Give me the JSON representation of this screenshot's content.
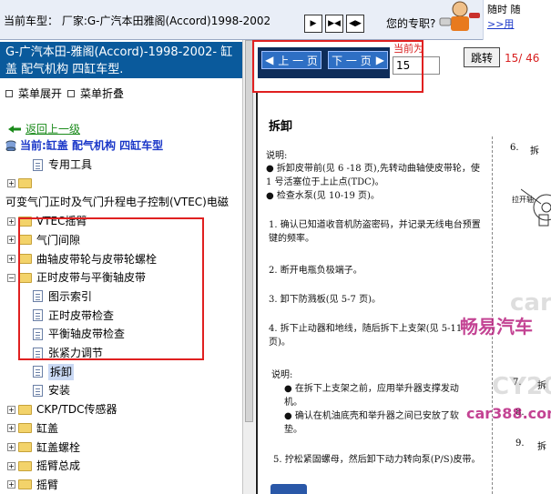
{
  "header": {
    "model_label": "当前车型： 厂家:G-广汽本田雅阁(Accord)1998-2002",
    "nav_buttons": [
      "▶",
      "▶◀",
      "◀▶"
    ],
    "purchase_label": "您的专职?",
    "promo_text": "随时 随",
    "promo_link": ">>用"
  },
  "left": {
    "model_title": "G-广汽本田-雅阁(Accord)-1998-2002- 缸盖 配气机构 四缸车型.",
    "menu_expand": "菜单展开",
    "menu_collapse": "菜单折叠",
    "back_link": "返回上一级",
    "current": "当前:缸盖 配气机构 四缸车型",
    "tree": [
      {
        "label": "专用工具",
        "type": "doc",
        "level": 1
      },
      {
        "label": "",
        "type": "folder",
        "level": 0
      },
      {
        "label": "可变气门正时及气门升程电子控制(VTEC)电磁",
        "type": "text",
        "level": 0
      },
      {
        "label": "VTEC摇臂",
        "type": "folder",
        "level": 0
      },
      {
        "label": "气门间隙",
        "type": "folder",
        "level": 0
      },
      {
        "label": "曲轴皮带轮与皮带轮螺栓",
        "type": "folder",
        "level": 0
      },
      {
        "label": "正时皮带与平衡轴皮带",
        "type": "folder",
        "level": 0,
        "expanded": true
      },
      {
        "label": "图示索引",
        "type": "doc",
        "level": 1
      },
      {
        "label": "正时皮带检查",
        "type": "doc",
        "level": 1
      },
      {
        "label": "平衡轴皮带检查",
        "type": "doc",
        "level": 1
      },
      {
        "label": "张紧力调节",
        "type": "doc",
        "level": 1
      },
      {
        "label": "拆卸",
        "type": "doc",
        "level": 1,
        "selected": true
      },
      {
        "label": "安装",
        "type": "doc",
        "level": 1
      },
      {
        "label": "CKP/TDC传感器",
        "type": "folder",
        "level": 0
      },
      {
        "label": "缸盖",
        "type": "folder",
        "level": 0
      },
      {
        "label": "缸盖螺栓",
        "type": "folder",
        "level": 0
      },
      {
        "label": "摇臂总成",
        "type": "folder",
        "level": 0
      },
      {
        "label": "摇臂",
        "type": "folder",
        "level": 0
      }
    ]
  },
  "pager": {
    "prev_label": "上 一 页",
    "next_label": "下 一 页",
    "current_page_label": "当前为",
    "page_value": "15",
    "jump_label": "跳转",
    "page_count": "15/ 46"
  },
  "doc": {
    "heading": "拆卸",
    "note_label": "说明:",
    "note_items": [
      "拆卸皮带前(见 6 -18 页),先转动曲轴使皮带轮，使 1 号活塞位于上止点(TDC)。",
      "检查水泵(见 10-19 页)。"
    ],
    "steps": [
      "1. 确认已知道收音机防盗密码，并记录无线电台预置键的频率。",
      "2. 断开电瓶负极端子。",
      "3. 卸下防溅板(见 5-7 页)。",
      "4. 拆下止动器和地线，随后拆下上支架(见 5-11 页)。"
    ],
    "note2_label": "说明:",
    "note2_items": [
      "在拆下上支架之前，应用举升器支撑发动机。",
      "确认在机油底壳和举升器之间已安放了软垫。"
    ],
    "step5": "5. 拧松紧固螺母，然后卸下动力转向泵(P/S)皮带。",
    "right_numbers": [
      "6.",
      "拆",
      "7.",
      "拆",
      "8.",
      "9.",
      "拆"
    ],
    "illus_label": "拉开轴",
    "watermark_main": "畅易汽车",
    "watermark_url": "car388.com",
    "watermark_faint": [
      "car38",
      "CY20"
    ]
  },
  "colors": {
    "title_bg": "#0a5a9c",
    "highlight": "#e02020",
    "page_count": "#d82020",
    "link_green": "#1a8a1a",
    "link_blue": "#1a37c8"
  }
}
